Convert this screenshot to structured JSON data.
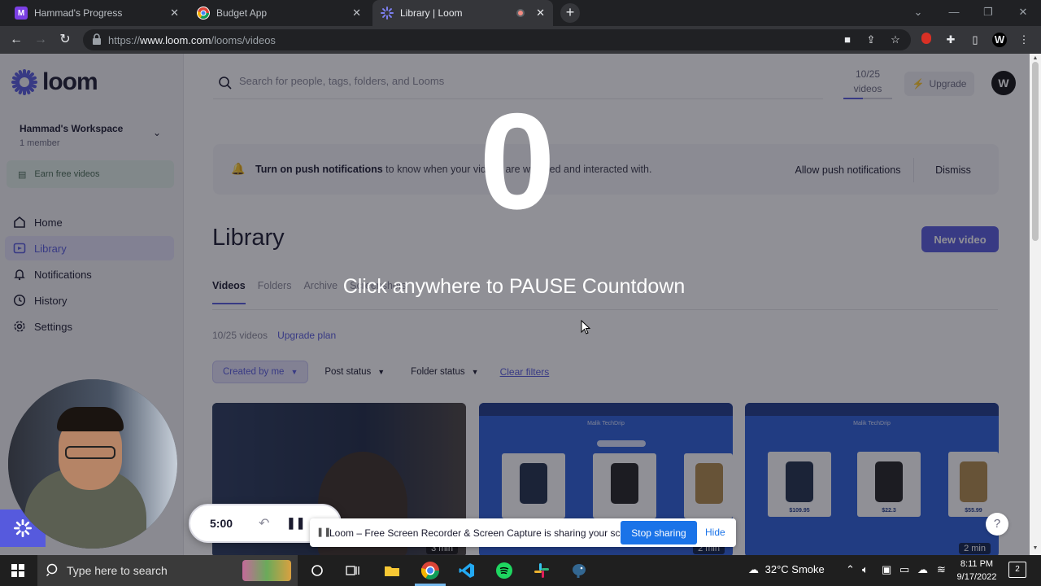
{
  "browser": {
    "tabs": [
      {
        "title": "Hammad's Progress",
        "favicon_color": "#7b3fe4",
        "favicon_letter": "M"
      },
      {
        "title": "Budget App",
        "favicon_color": "#ffffff",
        "favicon_letter": ""
      },
      {
        "title": "Library | Loom",
        "favicon_color": "#565add",
        "favicon_letter": "",
        "recording": true
      }
    ],
    "url_prefix": "https://",
    "url_host": "www.loom.com",
    "url_path": "/looms/videos"
  },
  "sidebar": {
    "brand": "loom",
    "workspace_name": "Hammad's Workspace",
    "workspace_members": "1 member",
    "earn_label": "Earn free videos",
    "nav": [
      {
        "label": "Home",
        "icon": "home-icon"
      },
      {
        "label": "Library",
        "icon": "library-icon",
        "active": true
      },
      {
        "label": "Notifications",
        "icon": "bell-icon"
      },
      {
        "label": "History",
        "icon": "clock-icon"
      },
      {
        "label": "Settings",
        "icon": "gear-icon"
      }
    ]
  },
  "header": {
    "search_placeholder": "Search for people, tags, folders, and Looms",
    "quota_count": "10/25",
    "quota_unit": "videos",
    "quota_used_fraction": 0.4,
    "upgrade_label": "Upgrade",
    "avatar_letter": "W"
  },
  "banner": {
    "bold": "Turn on push notifications",
    "rest": " to know when your videos are watched and interacted with.",
    "allow_label": "Allow push notifications",
    "dismiss_label": "Dismiss"
  },
  "library": {
    "title": "Library",
    "new_video_label": "New video",
    "tabs": [
      "Videos",
      "Folders",
      "Archive",
      "Screenshots"
    ],
    "count_text": "10/25 videos",
    "upgrade_plan_text": "Upgrade plan",
    "filters": [
      "Created by me",
      "Post status",
      "Folder status"
    ],
    "clear_filters": "Clear filters",
    "cards": [
      {
        "duration": "3 min",
        "type": "webcam"
      },
      {
        "duration": "2 min",
        "type": "shop",
        "shop_title": "Malik TechDrip",
        "prices": [
          "",
          "",
          ""
        ]
      },
      {
        "duration": "2 min",
        "type": "shop",
        "shop_title": "Malik TechDrip",
        "prices": [
          "$109.95",
          "$22.3",
          "$55.99"
        ]
      }
    ]
  },
  "overlay": {
    "countdown": "0",
    "hint": "Click anywhere to PAUSE Countdown"
  },
  "recorder": {
    "time": "5:00",
    "share_text": "Loom – Free Screen Recorder & Screen Capture is sharing your screen.",
    "stop_label": "Stop sharing",
    "hide_label": "Hide"
  },
  "taskbar": {
    "search_placeholder": "Type here to search",
    "weather": "32°C  Smoke",
    "time": "8:11 PM",
    "date": "9/17/2022",
    "notif_count": "2"
  },
  "colors": {
    "accent": "#565add",
    "chrome_bg": "#202124",
    "taskbar_bg": "#1f1f1f"
  }
}
